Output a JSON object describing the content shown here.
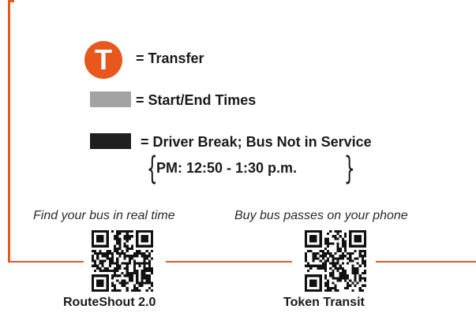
{
  "legend": {
    "transfer_symbol": "T",
    "transfer_label": "= Transfer",
    "start_end_label": "= Start/End Times",
    "driver_break_label": "= Driver Break; Bus Not in Service",
    "break_time": "PM: 12:50 - 1:30 p.m."
  },
  "colors": {
    "accent": "#E8581C",
    "start_end_swatch": "#a3a3a3",
    "driver_break_swatch": "#1f1f1f"
  },
  "apps": [
    {
      "caption": "Find your bus in real time",
      "name": "RouteShout 2.0",
      "icon": "qr-code-icon"
    },
    {
      "caption": "Buy bus passes on your phone",
      "name": "Token Transit",
      "icon": "qr-code-icon"
    }
  ]
}
